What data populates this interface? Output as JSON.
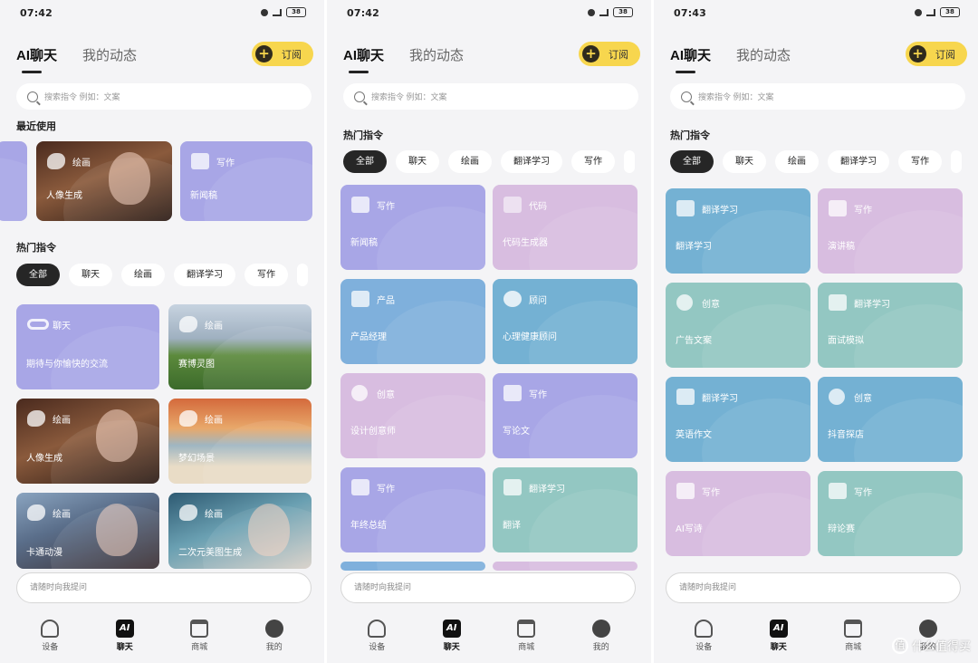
{
  "phones": [
    {
      "status_time": "07:42",
      "battery": "38",
      "tabs": [
        "AI聊天",
        "我的动态"
      ],
      "subscribe_label": "订阅",
      "search_placeholder": "搜索指令 例如：文案",
      "recent_title": "最近使用",
      "recent_cards": [
        {
          "category": "绘画",
          "name": "人像生成"
        },
        {
          "category": "写作",
          "name": "新闻稿"
        }
      ],
      "hot_title": "热门指令",
      "chips": [
        "全部",
        "聊天",
        "绘画",
        "翻译学习",
        "写作"
      ],
      "cards": [
        {
          "category": "聊天",
          "name": "期待与你愉快的交流"
        },
        {
          "category": "绘画",
          "name": "赛博灵图"
        },
        {
          "category": "绘画",
          "name": "人像生成"
        },
        {
          "category": "绘画",
          "name": "梦幻场景"
        },
        {
          "category": "绘画",
          "name": "卡通动漫"
        },
        {
          "category": "绘画",
          "name": "二次元美图生成"
        }
      ],
      "ask_placeholder": "请随时向我提问",
      "nav": [
        "设备",
        "聊天",
        "商城",
        "我的"
      ]
    },
    {
      "status_time": "07:42",
      "battery": "38",
      "tabs": [
        "AI聊天",
        "我的动态"
      ],
      "subscribe_label": "订阅",
      "search_placeholder": "搜索指令 例如：文案",
      "hot_title": "热门指令",
      "chips": [
        "全部",
        "聊天",
        "绘画",
        "翻译学习",
        "写作"
      ],
      "cards": [
        {
          "category": "写作",
          "name": "新闻稿"
        },
        {
          "category": "代码",
          "name": "代码生成器"
        },
        {
          "category": "产品",
          "name": "产品经理"
        },
        {
          "category": "顾问",
          "name": "心理健康顾问"
        },
        {
          "category": "创意",
          "name": "设计创意师"
        },
        {
          "category": "写作",
          "name": "写论文"
        },
        {
          "category": "写作",
          "name": "年终总结"
        },
        {
          "category": "翻译学习",
          "name": "翻译"
        }
      ],
      "ask_placeholder": "请随时向我提问",
      "nav": [
        "设备",
        "聊天",
        "商城",
        "我的"
      ]
    },
    {
      "status_time": "07:43",
      "battery": "38",
      "tabs": [
        "AI聊天",
        "我的动态"
      ],
      "subscribe_label": "订阅",
      "search_placeholder": "搜索指令 例如：文案",
      "hot_title": "热门指令",
      "chips": [
        "全部",
        "聊天",
        "绘画",
        "翻译学习",
        "写作"
      ],
      "cards": [
        {
          "category": "翻译学习",
          "name": "翻译学习"
        },
        {
          "category": "写作",
          "name": "演讲稿"
        },
        {
          "category": "创意",
          "name": "广告文案"
        },
        {
          "category": "翻译学习",
          "name": "面试模拟"
        },
        {
          "category": "翻译学习",
          "name": "英语作文"
        },
        {
          "category": "创意",
          "name": "抖音探店"
        },
        {
          "category": "写作",
          "name": "AI写诗"
        },
        {
          "category": "写作",
          "name": "辩论赛"
        }
      ],
      "ask_placeholder": "请随时向我提问",
      "nav": [
        "设备",
        "聊天",
        "商城",
        "我的"
      ]
    }
  ],
  "watermark": "什么值得买",
  "watermark_logo": "值"
}
